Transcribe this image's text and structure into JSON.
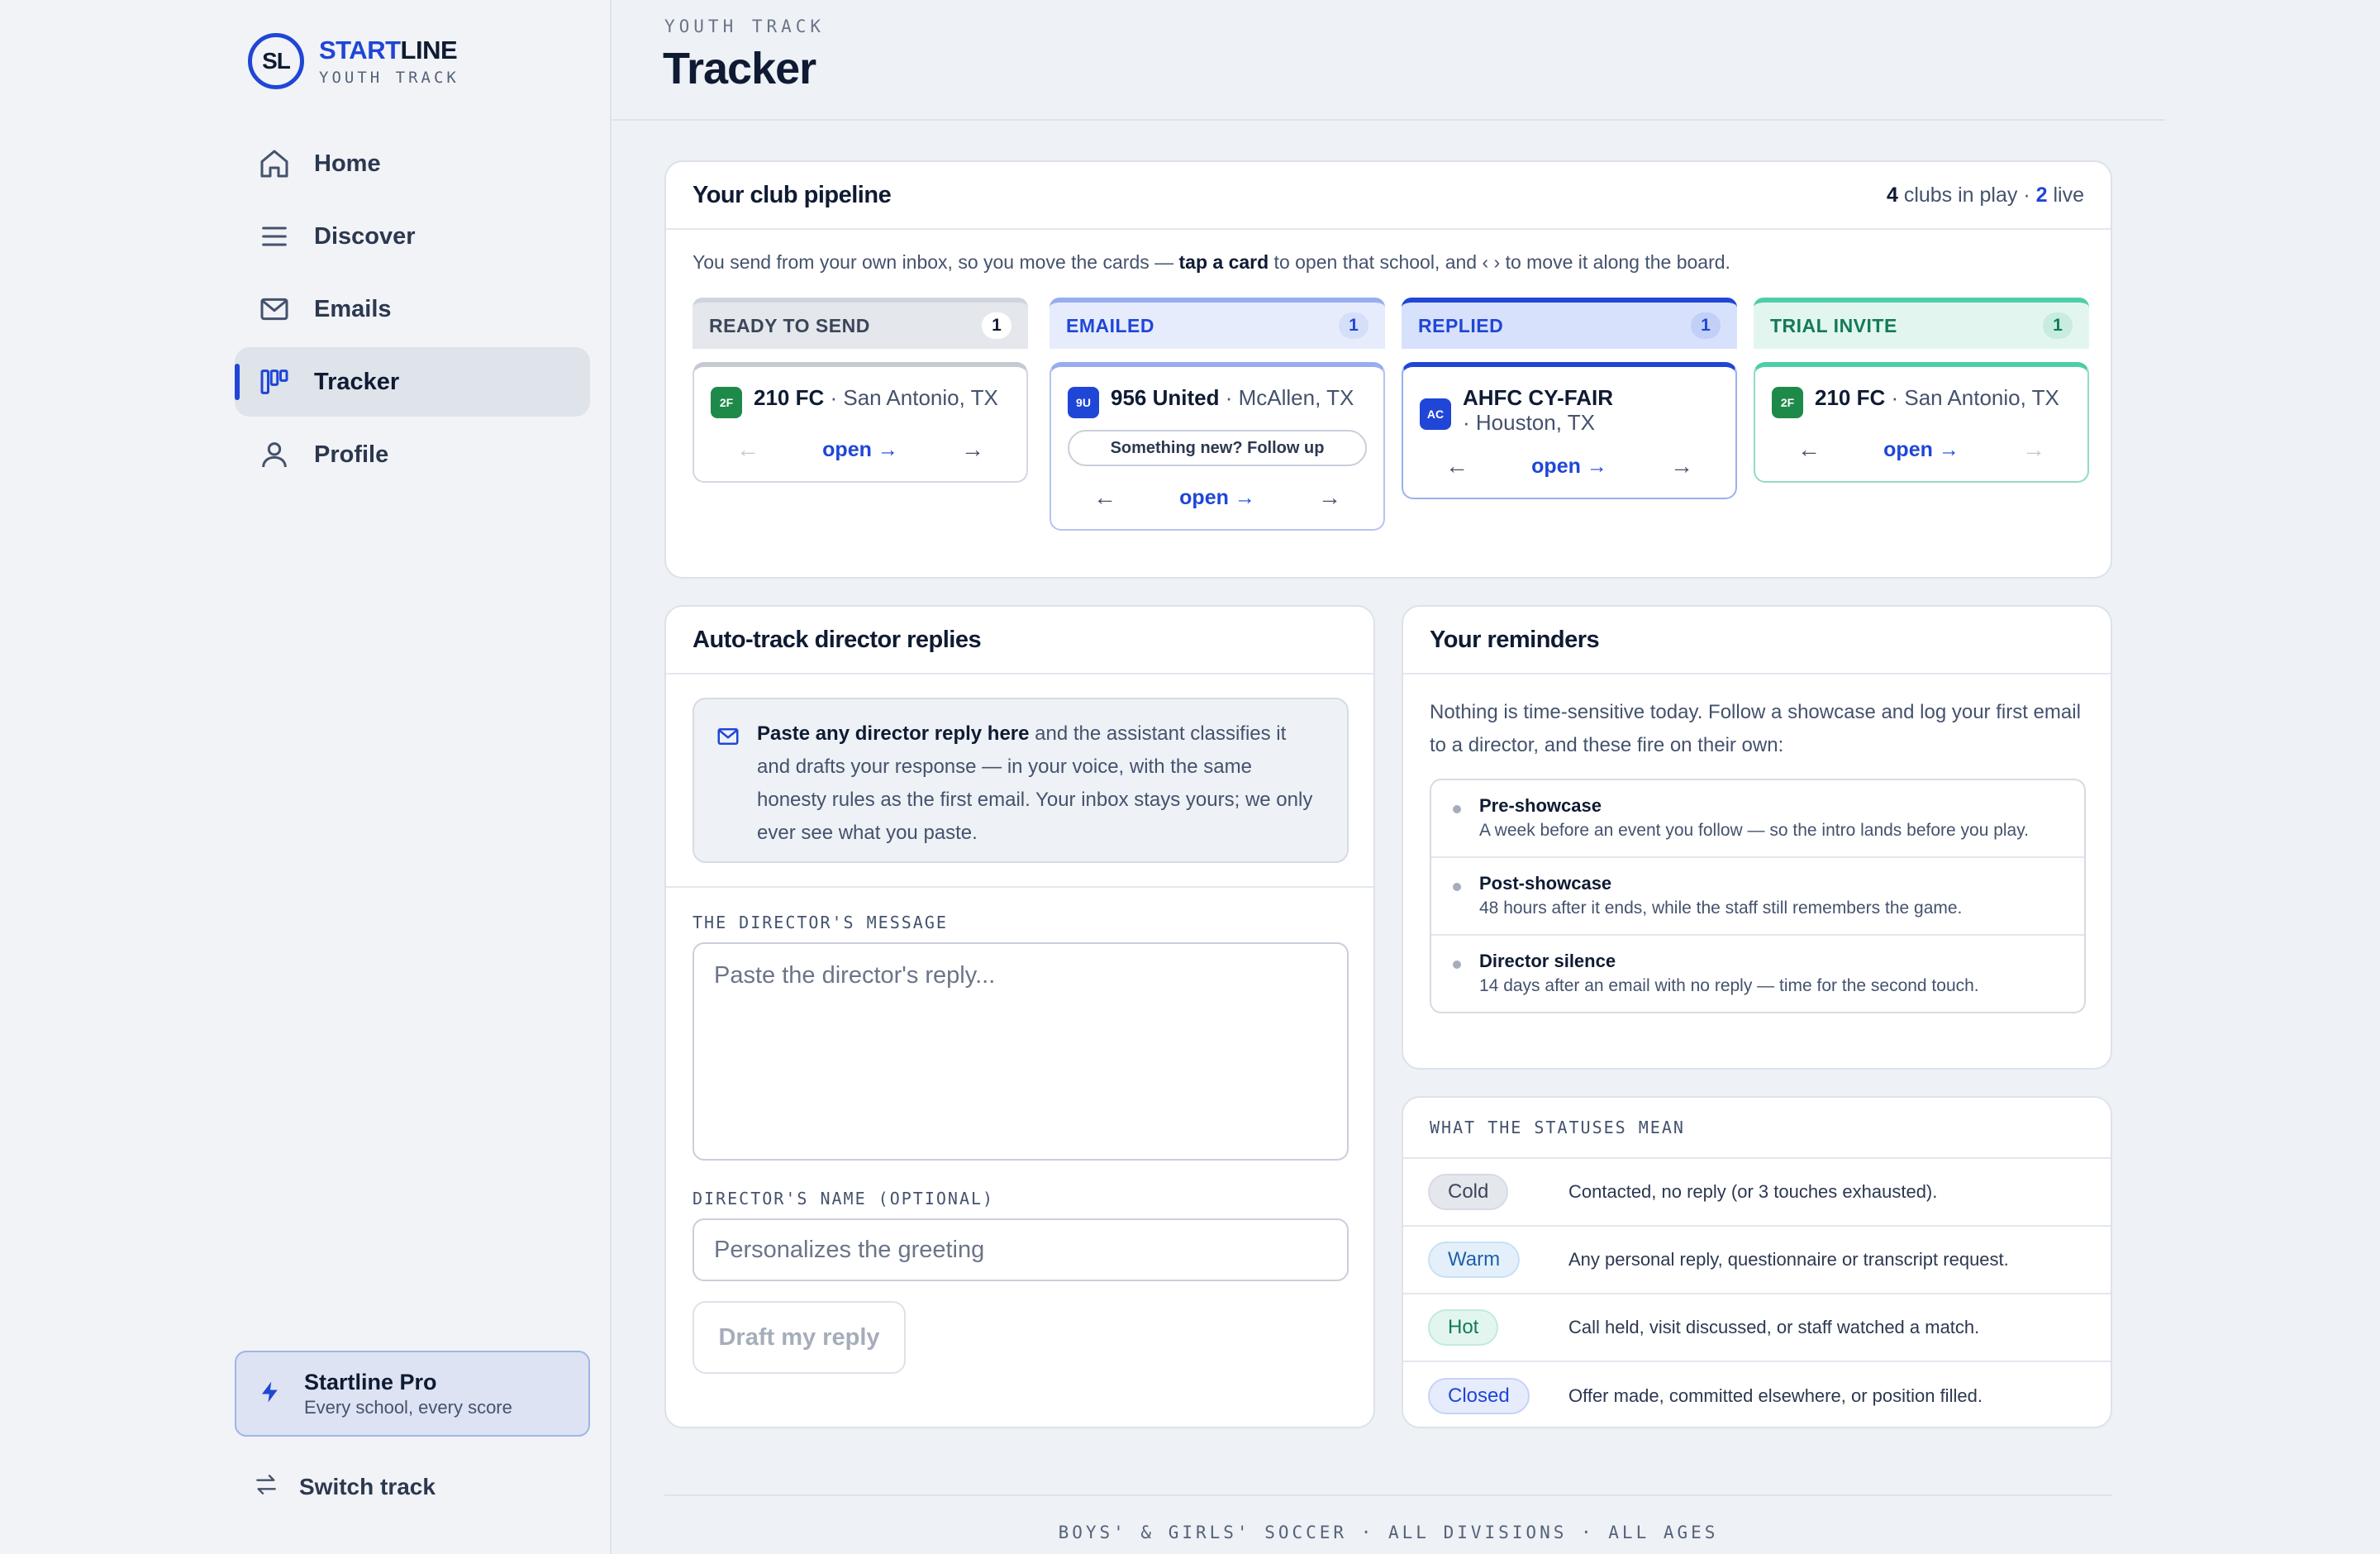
{
  "brand": {
    "name_part1": "START",
    "name_part2": "LINE",
    "sub": "YOUTH TRACK",
    "mark": "SL"
  },
  "nav": {
    "items": [
      {
        "label": "Home",
        "icon": "home-icon"
      },
      {
        "label": "Discover",
        "icon": "menu-icon"
      },
      {
        "label": "Emails",
        "icon": "mail-icon"
      },
      {
        "label": "Tracker",
        "icon": "board-icon",
        "active": true
      },
      {
        "label": "Profile",
        "icon": "user-icon"
      }
    ]
  },
  "pro": {
    "title": "Startline Pro",
    "sub": "Every school, every score"
  },
  "switch_track": {
    "label": "Switch track"
  },
  "header": {
    "eyebrow": "YOUTH TRACK",
    "title": "Tracker"
  },
  "pipeline": {
    "title": "Your club pipeline",
    "clubs_count": "4",
    "clubs_label": "clubs in play ·",
    "live_count": "2",
    "live_label": "live",
    "help_pre": "You send from your own inbox, so you move the cards — ",
    "help_bold": "tap a card",
    "help_post": " to open that school, and ‹ › to move it along the board.",
    "columns": [
      {
        "label": "READY TO SEND",
        "count": "1",
        "card": {
          "badge": "2F",
          "name": "210 FC",
          "location": "· San Antonio, TX",
          "open": "open"
        }
      },
      {
        "label": "EMAILED",
        "count": "1",
        "card": {
          "badge": "9U",
          "name": "956 United",
          "location": "· McAllen, TX",
          "follow": "Something new? Follow up",
          "open": "open"
        }
      },
      {
        "label": "REPLIED",
        "count": "1",
        "card": {
          "badge": "AC",
          "name": "AHFC CY-FAIR",
          "location": "· Houston, TX",
          "open": "open"
        }
      },
      {
        "label": "TRIAL INVITE",
        "count": "1",
        "card": {
          "badge": "2F",
          "name": "210 FC",
          "location": "· San Antonio, TX",
          "open": "open"
        }
      }
    ]
  },
  "autotrack": {
    "title": "Auto-track director replies",
    "info_bold": "Paste any director reply here",
    "info_rest": " and the assistant classifies it and drafts your response — in your voice, with the same honesty rules as the first email. Your inbox stays yours; we only ever see what you paste.",
    "message_label": "THE DIRECTOR'S MESSAGE",
    "message_placeholder": "Paste the director's reply...",
    "name_label": "DIRECTOR'S NAME (OPTIONAL)",
    "name_placeholder": "Personalizes the greeting",
    "draft_button": "Draft my reply"
  },
  "reminders": {
    "title": "Your reminders",
    "intro": "Nothing is time-sensitive today. Follow a showcase and log your first email to a director, and these fire on their own:",
    "items": [
      {
        "title": "Pre-showcase",
        "desc": "A week before an event you follow — so the intro lands before you play."
      },
      {
        "title": "Post-showcase",
        "desc": "48 hours after it ends, while the staff still remembers the game."
      },
      {
        "title": "Director silence",
        "desc": "14 days after an email with no reply — time for the second touch."
      }
    ]
  },
  "statuses": {
    "title": "WHAT THE STATUSES MEAN",
    "rows": [
      {
        "label": "Cold",
        "desc": "Contacted, no reply (or 3 touches exhausted)."
      },
      {
        "label": "Warm",
        "desc": "Any personal reply, questionnaire or transcript request."
      },
      {
        "label": "Hot",
        "desc": "Call held, visit discussed, or staff watched a match."
      },
      {
        "label": "Closed",
        "desc": "Offer made, committed elsewhere, or position filled."
      }
    ]
  },
  "footer": {
    "text": "BOYS' & GIRLS' SOCCER · ALL DIVISIONS · ALL AGES"
  },
  "colors": {
    "accent": "#1f46d6",
    "green": "#137a57",
    "badge_green": "#1e8a4a"
  }
}
